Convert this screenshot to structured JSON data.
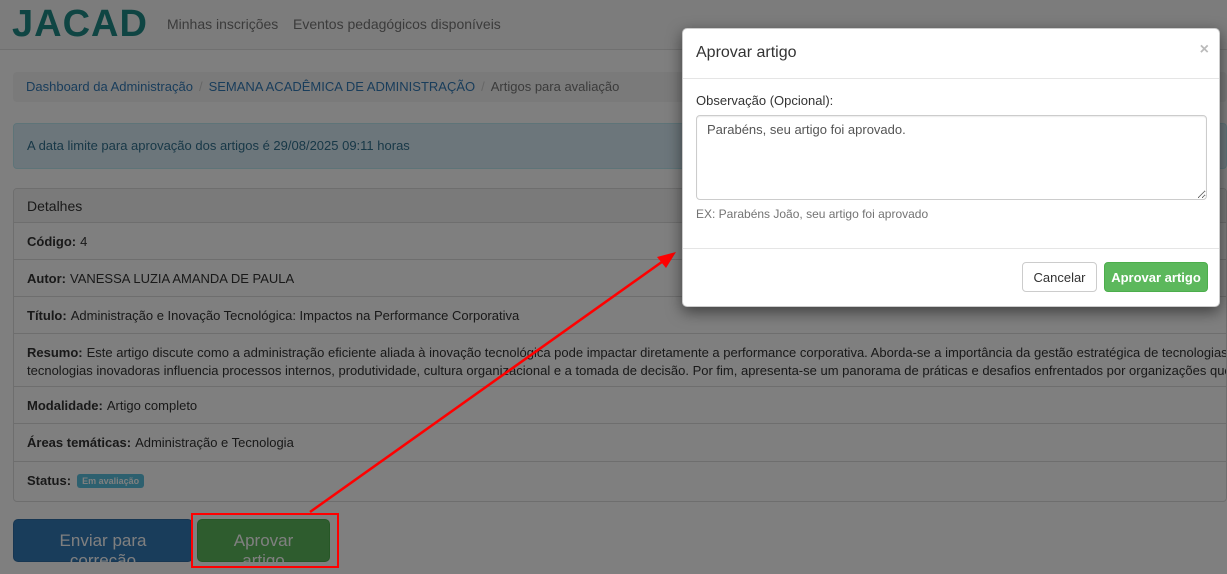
{
  "navbar": {
    "logo": "JACAD",
    "links": [
      "Minhas inscrições",
      "Eventos pedagógicos disponíveis"
    ]
  },
  "breadcrumb": {
    "items": [
      "Dashboard da Administração",
      "SEMANA ACADÊMICA DE ADMINISTRAÇÃO"
    ],
    "active": "Artigos para avaliação"
  },
  "alert": {
    "text": "A data limite para aprovação dos artigos é 29/08/2025 09:11 horas"
  },
  "details": {
    "heading": "Detalhes",
    "codigo_label": "Código:",
    "codigo": "4",
    "autor_label": "Autor:",
    "autor": "VANESSA LUZIA AMANDA DE PAULA",
    "titulo_label": "Título:",
    "titulo": "Administração e Inovação Tecnológica: Impactos na Performance Corporativa",
    "resumo_label": "Resumo:",
    "resumo_line1": "Este artigo discute como a administração eficiente aliada à inovação tecnológica pode impactar diretamente a performance corporativa. Aborda-se a importância da gestão estratégica de tecnologias emerg",
    "resumo_line2": "tecnologias inovadoras influencia processos internos, produtividade, cultura organizacional e a tomada de decisão. Por fim, apresenta-se um panorama de práticas e desafios enfrentados por organizações que busca",
    "modalidade_label": "Modalidade:",
    "modalidade": "Artigo completo",
    "areas_label": "Áreas temáticas:",
    "areas": "Administração e Tecnologia",
    "status_label": "Status:",
    "status": "Em avaliação"
  },
  "actions": {
    "correcao": "Enviar para correção",
    "aprovar": "Aprovar artigo"
  },
  "modal": {
    "title": "Aprovar artigo",
    "close": "×",
    "field_label": "Observação (Opcional):",
    "textarea_value": "Parabéns, seu artigo foi aprovado.",
    "help": "EX: Parabéns João, seu artigo foi aprovado",
    "cancel": "Cancelar",
    "confirm": "Aprovar artigo"
  },
  "colors": {
    "brand": "#1f8a87",
    "primary": "#337ab7",
    "success": "#5cb85c",
    "info": "#5bc0de",
    "annotation": "#ff0000"
  }
}
